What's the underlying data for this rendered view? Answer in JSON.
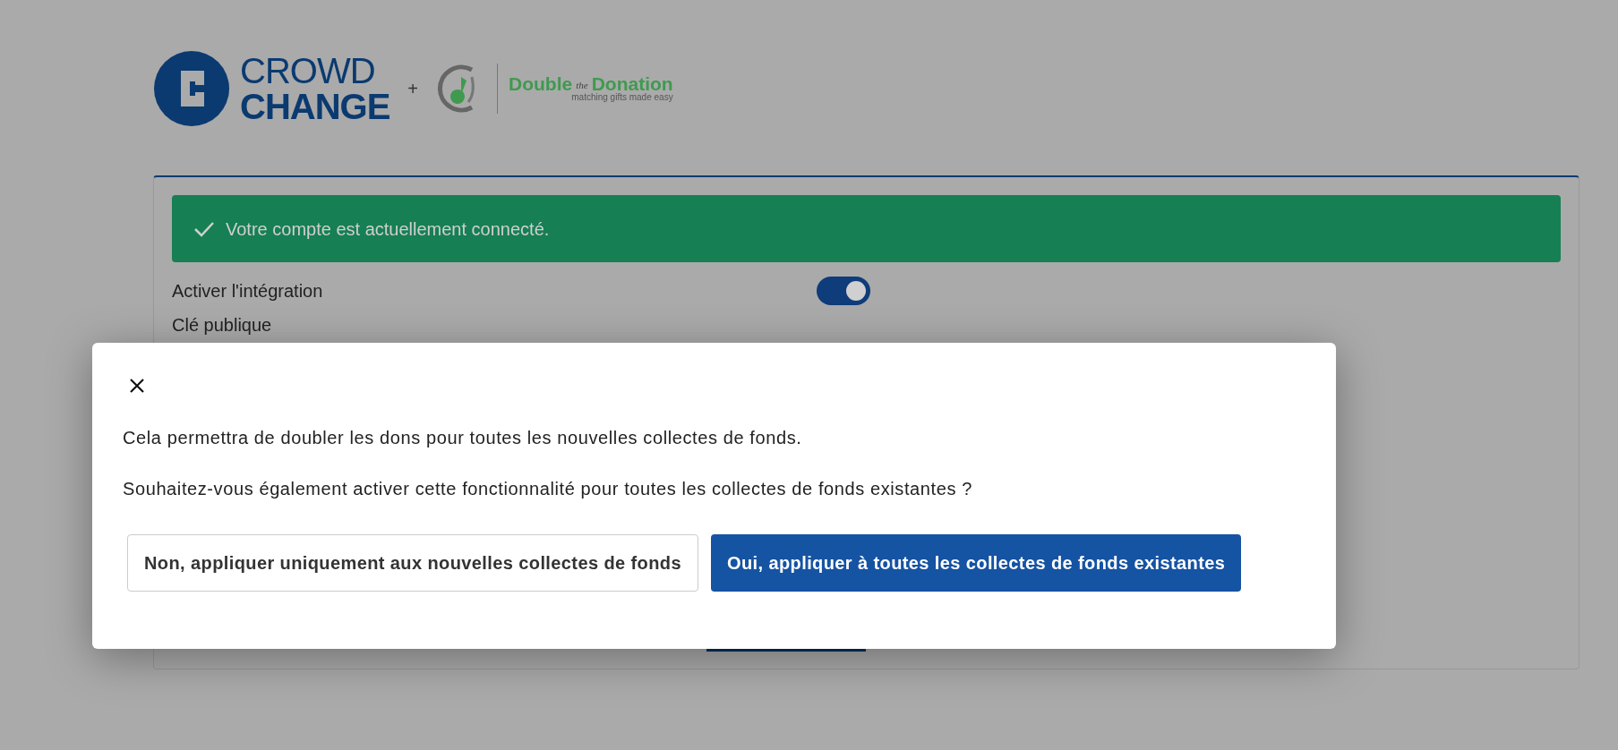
{
  "logos": {
    "brand_top": "CROWD",
    "brand_bottom": "CHANGE",
    "plus": "+",
    "partner_first": "Double",
    "partner_middle": "the",
    "partner_last": "Donation",
    "partner_tagline": "matching gifts made easy"
  },
  "alert": {
    "message": "Votre compte est actuellement connecté."
  },
  "settings": [
    {
      "kind": "toggle",
      "label": "Activer l'intégration",
      "on": true
    },
    {
      "kind": "field",
      "label": "Clé publique"
    }
  ],
  "dialog": {
    "paragraphs": [
      "Cela permettra de doubler les dons pour toutes les nouvelles collectes de fonds.",
      "Souhaitez-vous également activer cette fonctionnalité pour toutes les collectes de fonds existantes ?"
    ],
    "buttons": [
      {
        "label": "Non, appliquer uniquement aux nouvelles collectes de fonds",
        "kind": "secondary"
      },
      {
        "label": "Oui, appliquer à toutes les collectes de fonds existantes",
        "kind": "primary"
      }
    ]
  }
}
